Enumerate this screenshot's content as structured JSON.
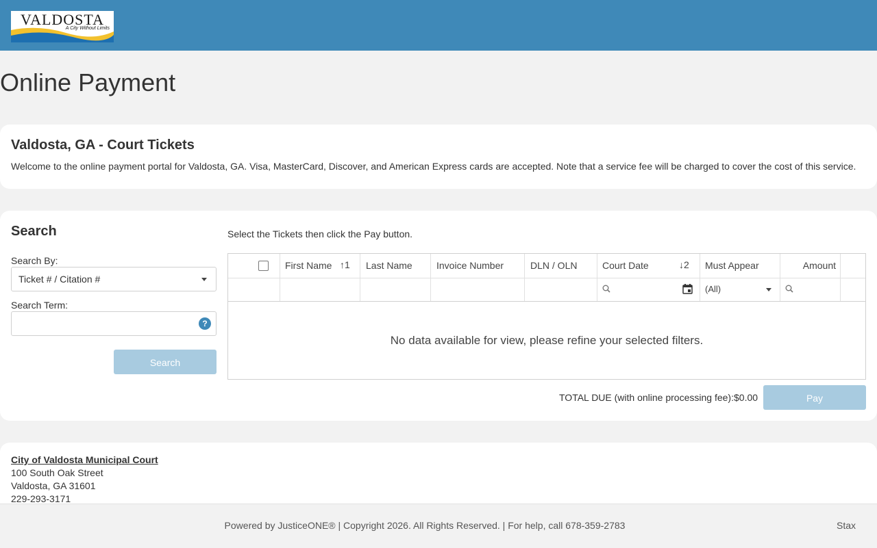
{
  "header": {
    "logo_text": "VALDOSTA",
    "logo_tagline": "A City Without Limits",
    "brand_color": "#3f89b8"
  },
  "page_title": "Online Payment",
  "intro": {
    "title": "Valdosta, GA - Court Tickets",
    "text": "Welcome to the online payment portal for Valdosta, GA. Visa, MasterCard, Discover, and American Express cards are accepted. Note that a service fee will be charged to cover the cost of this service."
  },
  "search": {
    "title": "Search",
    "search_by_label": "Search By:",
    "search_by_value": "Ticket # / Citation #",
    "search_term_label": "Search Term:",
    "search_term_value": "",
    "help_icon": "?",
    "search_button": "Search"
  },
  "grid": {
    "instruction": "Select the Tickets then click the Pay button.",
    "columns": [
      {
        "label": "First Name",
        "sort": "↑1"
      },
      {
        "label": "Last Name",
        "sort": ""
      },
      {
        "label": "Invoice Number",
        "sort": ""
      },
      {
        "label": "DLN / OLN",
        "sort": ""
      },
      {
        "label": "Court Date",
        "sort": "↓2"
      },
      {
        "label": "Must Appear",
        "sort": ""
      },
      {
        "label": "Amount",
        "sort": ""
      }
    ],
    "must_appear_filter": "(All)",
    "empty_message": "No data available for view, please refine your selected filters."
  },
  "totals": {
    "label": "TOTAL DUE (with online processing fee):",
    "value": "$0.00",
    "pay_button": "Pay"
  },
  "address": {
    "name": "City of Valdosta Municipal Court",
    "street": "100 South Oak Street",
    "city": "Valdosta, GA 31601",
    "phone": "229-293-3171"
  },
  "footer": {
    "text": "Powered by JusticeONE® | Copyright 2026. All Rights Reserved. | For help, call 678-359-2783",
    "right": "Stax"
  }
}
